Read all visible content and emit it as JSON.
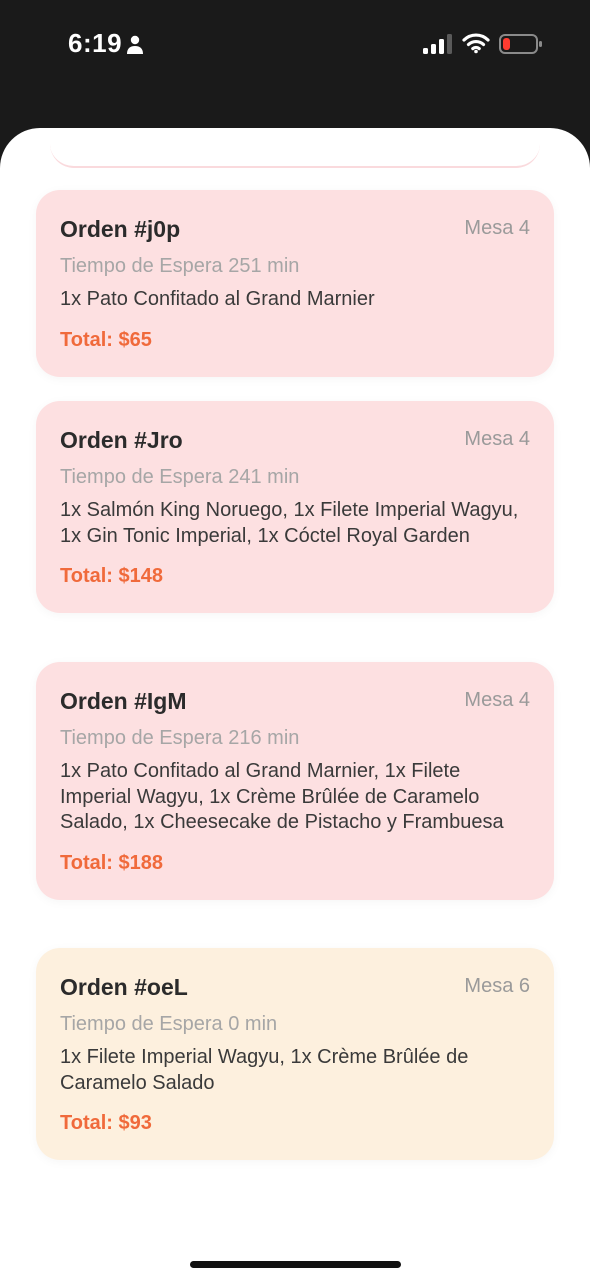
{
  "status_bar": {
    "time": "6:19",
    "icons": [
      "person-icon",
      "signal-icon",
      "wifi-icon",
      "battery-icon"
    ],
    "battery_color": "#ff3b30"
  },
  "colors": {
    "card_pink": "#fde0e1",
    "card_cream": "#fdf0de",
    "total_accent": "#f06a3b"
  },
  "orders": [
    {
      "title": "Orden #j0p",
      "table": "Mesa 4",
      "wait": "Tiempo de Espera 251 min",
      "items": "1x Pato Confitado al Grand Marnier",
      "total": "Total: $65"
    },
    {
      "title": "Orden #Jro",
      "table": "Mesa 4",
      "wait": "Tiempo de Espera 241 min",
      "items": "1x Salmón King Noruego, 1x Filete Imperial Wagyu, 1x Gin Tonic Imperial, 1x Cóctel Royal Garden",
      "total": "Total: $148"
    },
    {
      "title": "Orden #IgM",
      "table": "Mesa 4",
      "wait": "Tiempo de Espera 216 min",
      "items": "1x Pato Confitado al Grand Marnier, 1x Filete Imperial Wagyu, 1x Crème Brûlée de Caramelo Salado, 1x Cheesecake de Pistacho y Frambuesa",
      "total": "Total: $188"
    },
    {
      "title": "Orden #oeL",
      "table": "Mesa 6",
      "wait": "Tiempo de Espera 0 min",
      "items": "1x Filete Imperial Wagyu, 1x Crème Brûlée de Caramelo Salado",
      "total": "Total: $93"
    }
  ]
}
